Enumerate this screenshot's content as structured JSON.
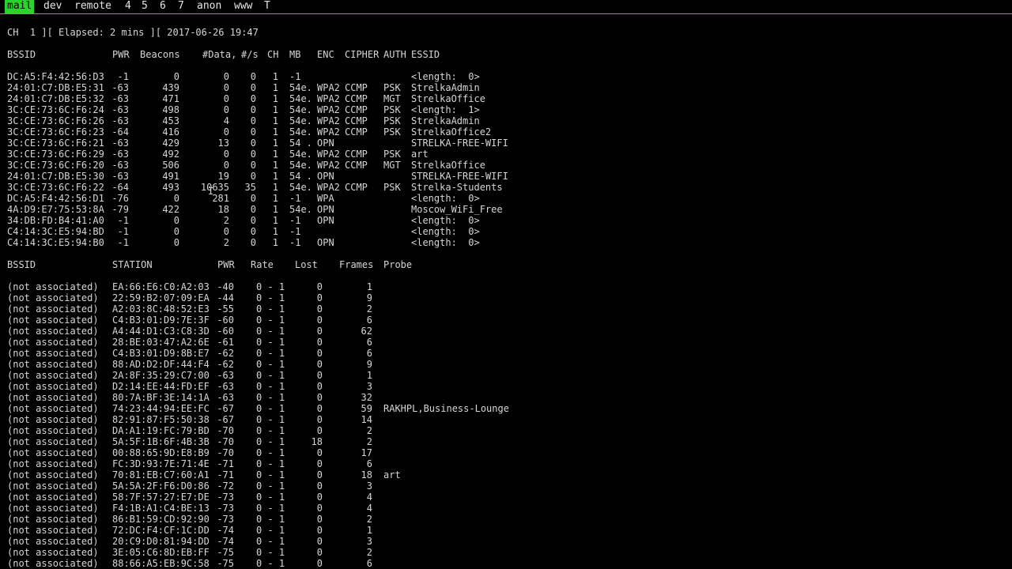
{
  "tabs": [
    "mail",
    "dev",
    "remote",
    "4",
    "5",
    "6",
    "7",
    "anon",
    "www",
    "T"
  ],
  "active_tab": "mail",
  "status_line": "CH  1 ][ Elapsed: 2 mins ][ 2017-06-26 19:47",
  "ap_headers": {
    "bssid": "BSSID",
    "pwr": "PWR",
    "beacons": "Beacons",
    "data": "#Data,",
    "rate": "#/s",
    "ch": "CH",
    "mb": "MB",
    "enc": "ENC",
    "cipher": "CIPHER",
    "auth": "AUTH",
    "essid": "ESSID"
  },
  "access_points": [
    {
      "bssid": "DC:A5:F4:42:56:D3",
      "pwr": "-1",
      "beacons": "0",
      "data": "0",
      "rate": "0",
      "ch": "1",
      "mb": "-1",
      "enc": "",
      "cipher": "",
      "auth": "",
      "essid": "<length:  0>"
    },
    {
      "bssid": "24:01:C7:DB:E5:31",
      "pwr": "-63",
      "beacons": "439",
      "data": "0",
      "rate": "0",
      "ch": "1",
      "mb": "54e.",
      "enc": "WPA2",
      "cipher": "CCMP",
      "auth": "PSK",
      "essid": "StrelkaAdmin"
    },
    {
      "bssid": "24:01:C7:DB:E5:32",
      "pwr": "-63",
      "beacons": "471",
      "data": "0",
      "rate": "0",
      "ch": "1",
      "mb": "54e.",
      "enc": "WPA2",
      "cipher": "CCMP",
      "auth": "MGT",
      "essid": "StrelkaOffice"
    },
    {
      "bssid": "3C:CE:73:6C:F6:24",
      "pwr": "-63",
      "beacons": "498",
      "data": "0",
      "rate": "0",
      "ch": "1",
      "mb": "54e.",
      "enc": "WPA2",
      "cipher": "CCMP",
      "auth": "PSK",
      "essid": "<length:  1>"
    },
    {
      "bssid": "3C:CE:73:6C:F6:26",
      "pwr": "-63",
      "beacons": "453",
      "data": "4",
      "rate": "0",
      "ch": "1",
      "mb": "54e.",
      "enc": "WPA2",
      "cipher": "CCMP",
      "auth": "PSK",
      "essid": "StrelkaAdmin"
    },
    {
      "bssid": "3C:CE:73:6C:F6:23",
      "pwr": "-64",
      "beacons": "416",
      "data": "0",
      "rate": "0",
      "ch": "1",
      "mb": "54e.",
      "enc": "WPA2",
      "cipher": "CCMP",
      "auth": "PSK",
      "essid": "StrelkaOffice2"
    },
    {
      "bssid": "3C:CE:73:6C:F6:21",
      "pwr": "-63",
      "beacons": "429",
      "data": "13",
      "rate": "0",
      "ch": "1",
      "mb": "54 .",
      "enc": "OPN",
      "cipher": "",
      "auth": "",
      "essid": "STRELKA-FREE-WIFI"
    },
    {
      "bssid": "3C:CE:73:6C:F6:29",
      "pwr": "-63",
      "beacons": "492",
      "data": "0",
      "rate": "0",
      "ch": "1",
      "mb": "54e.",
      "enc": "WPA2",
      "cipher": "CCMP",
      "auth": "PSK",
      "essid": "art"
    },
    {
      "bssid": "3C:CE:73:6C:F6:20",
      "pwr": "-63",
      "beacons": "506",
      "data": "0",
      "rate": "0",
      "ch": "1",
      "mb": "54e.",
      "enc": "WPA2",
      "cipher": "CCMP",
      "auth": "MGT",
      "essid": "StrelkaOffice"
    },
    {
      "bssid": "24:01:C7:DB:E5:30",
      "pwr": "-63",
      "beacons": "491",
      "data": "19",
      "rate": "0",
      "ch": "1",
      "mb": "54 .",
      "enc": "OPN",
      "cipher": "",
      "auth": "",
      "essid": "STRELKA-FREE-WIFI"
    },
    {
      "bssid": "3C:CE:73:6C:F6:22",
      "pwr": "-64",
      "beacons": "493",
      "data": "10635",
      "rate": "35",
      "ch": "1",
      "mb": "54e.",
      "enc": "WPA2",
      "cipher": "CCMP",
      "auth": "PSK",
      "essid": "Strelka-Students"
    },
    {
      "bssid": "DC:A5:F4:42:56:D1",
      "pwr": "-76",
      "beacons": "0",
      "data": "281",
      "rate": "0",
      "ch": "1",
      "mb": "-1",
      "enc": "WPA",
      "cipher": "",
      "auth": "",
      "essid": "<length:  0>"
    },
    {
      "bssid": "4A:D9:E7:75:53:8A",
      "pwr": "-79",
      "beacons": "422",
      "data": "18",
      "rate": "0",
      "ch": "1",
      "mb": "54e.",
      "enc": "OPN",
      "cipher": "",
      "auth": "",
      "essid": "Moscow_WiFi_Free"
    },
    {
      "bssid": "34:DB:FD:B4:41:A0",
      "pwr": "-1",
      "beacons": "0",
      "data": "2",
      "rate": "0",
      "ch": "1",
      "mb": "-1",
      "enc": "OPN",
      "cipher": "",
      "auth": "",
      "essid": "<length:  0>"
    },
    {
      "bssid": "C4:14:3C:E5:94:BD",
      "pwr": "-1",
      "beacons": "0",
      "data": "0",
      "rate": "0",
      "ch": "1",
      "mb": "-1",
      "enc": "",
      "cipher": "",
      "auth": "",
      "essid": "<length:  0>"
    },
    {
      "bssid": "C4:14:3C:E5:94:B0",
      "pwr": "-1",
      "beacons": "0",
      "data": "2",
      "rate": "0",
      "ch": "1",
      "mb": "-1",
      "enc": "OPN",
      "cipher": "",
      "auth": "",
      "essid": "<length:  0>"
    }
  ],
  "station_headers": {
    "bssid": "BSSID",
    "station": "STATION",
    "pwr": "PWR",
    "rate": "Rate",
    "lost": "Lost",
    "frames": "Frames",
    "probe": "Probe"
  },
  "stations": [
    {
      "bssid": "(not associated)",
      "station": "EA:66:E6:C0:A2:03",
      "pwr": "-40",
      "rate": "0 - 1",
      "lost": "0",
      "frames": "1",
      "probe": ""
    },
    {
      "bssid": "(not associated)",
      "station": "22:59:B2:07:09:EA",
      "pwr": "-44",
      "rate": "0 - 1",
      "lost": "0",
      "frames": "9",
      "probe": ""
    },
    {
      "bssid": "(not associated)",
      "station": "A2:03:8C:48:52:E3",
      "pwr": "-55",
      "rate": "0 - 1",
      "lost": "0",
      "frames": "2",
      "probe": ""
    },
    {
      "bssid": "(not associated)",
      "station": "C4:B3:01:D9:7E:3F",
      "pwr": "-60",
      "rate": "0 - 1",
      "lost": "0",
      "frames": "6",
      "probe": ""
    },
    {
      "bssid": "(not associated)",
      "station": "A4:44:D1:C3:C8:3D",
      "pwr": "-60",
      "rate": "0 - 1",
      "lost": "0",
      "frames": "62",
      "probe": ""
    },
    {
      "bssid": "(not associated)",
      "station": "28:BE:03:47:A2:6E",
      "pwr": "-61",
      "rate": "0 - 1",
      "lost": "0",
      "frames": "6",
      "probe": ""
    },
    {
      "bssid": "(not associated)",
      "station": "C4:B3:01:D9:8B:E7",
      "pwr": "-62",
      "rate": "0 - 1",
      "lost": "0",
      "frames": "6",
      "probe": ""
    },
    {
      "bssid": "(not associated)",
      "station": "88:AD:D2:DF:44:F4",
      "pwr": "-62",
      "rate": "0 - 1",
      "lost": "0",
      "frames": "9",
      "probe": ""
    },
    {
      "bssid": "(not associated)",
      "station": "2A:8F:35:29:C7:00",
      "pwr": "-63",
      "rate": "0 - 1",
      "lost": "0",
      "frames": "1",
      "probe": ""
    },
    {
      "bssid": "(not associated)",
      "station": "D2:14:EE:44:FD:EF",
      "pwr": "-63",
      "rate": "0 - 1",
      "lost": "0",
      "frames": "3",
      "probe": ""
    },
    {
      "bssid": "(not associated)",
      "station": "80:7A:BF:3E:14:1A",
      "pwr": "-63",
      "rate": "0 - 1",
      "lost": "0",
      "frames": "32",
      "probe": ""
    },
    {
      "bssid": "(not associated)",
      "station": "74:23:44:94:EE:FC",
      "pwr": "-67",
      "rate": "0 - 1",
      "lost": "0",
      "frames": "59",
      "probe": "RAKHPL,Business-Lounge"
    },
    {
      "bssid": "(not associated)",
      "station": "82:91:87:F5:50:38",
      "pwr": "-67",
      "rate": "0 - 1",
      "lost": "0",
      "frames": "14",
      "probe": ""
    },
    {
      "bssid": "(not associated)",
      "station": "DA:A1:19:FC:79:BD",
      "pwr": "-70",
      "rate": "0 - 1",
      "lost": "0",
      "frames": "2",
      "probe": ""
    },
    {
      "bssid": "(not associated)",
      "station": "5A:5F:1B:6F:4B:3B",
      "pwr": "-70",
      "rate": "0 - 1",
      "lost": "18",
      "frames": "2",
      "probe": ""
    },
    {
      "bssid": "(not associated)",
      "station": "00:88:65:9D:E8:B9",
      "pwr": "-70",
      "rate": "0 - 1",
      "lost": "0",
      "frames": "17",
      "probe": ""
    },
    {
      "bssid": "(not associated)",
      "station": "FC:3D:93:7E:71:4E",
      "pwr": "-71",
      "rate": "0 - 1",
      "lost": "0",
      "frames": "6",
      "probe": ""
    },
    {
      "bssid": "(not associated)",
      "station": "70:81:EB:C7:60:A1",
      "pwr": "-71",
      "rate": "0 - 1",
      "lost": "0",
      "frames": "18",
      "probe": "art"
    },
    {
      "bssid": "(not associated)",
      "station": "5A:5A:2F:F6:D0:86",
      "pwr": "-72",
      "rate": "0 - 1",
      "lost": "0",
      "frames": "3",
      "probe": ""
    },
    {
      "bssid": "(not associated)",
      "station": "58:7F:57:27:E7:DE",
      "pwr": "-73",
      "rate": "0 - 1",
      "lost": "0",
      "frames": "4",
      "probe": ""
    },
    {
      "bssid": "(not associated)",
      "station": "F4:1B:A1:C4:BE:13",
      "pwr": "-73",
      "rate": "0 - 1",
      "lost": "0",
      "frames": "4",
      "probe": ""
    },
    {
      "bssid": "(not associated)",
      "station": "86:B1:59:CD:92:90",
      "pwr": "-73",
      "rate": "0 - 1",
      "lost": "0",
      "frames": "2",
      "probe": ""
    },
    {
      "bssid": "(not associated)",
      "station": "72:DC:F4:CF:1C:DD",
      "pwr": "-74",
      "rate": "0 - 1",
      "lost": "0",
      "frames": "1",
      "probe": ""
    },
    {
      "bssid": "(not associated)",
      "station": "20:C9:D0:81:94:DD",
      "pwr": "-74",
      "rate": "0 - 1",
      "lost": "0",
      "frames": "3",
      "probe": ""
    },
    {
      "bssid": "(not associated)",
      "station": "3E:05:C6:8D:EB:FF",
      "pwr": "-75",
      "rate": "0 - 1",
      "lost": "0",
      "frames": "2",
      "probe": ""
    },
    {
      "bssid": "(not associated)",
      "station": "88:66:A5:EB:9C:58",
      "pwr": "-75",
      "rate": "0 - 1",
      "lost": "0",
      "frames": "6",
      "probe": ""
    }
  ],
  "cursor_glyph": "I"
}
